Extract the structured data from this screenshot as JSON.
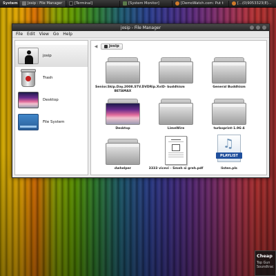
{
  "taskbar": {
    "items": [
      {
        "label": "System",
        "icon": "system-menu-icon"
      },
      {
        "label": "Josip : File Manager",
        "icon": "folder-icon"
      },
      {
        "label": "[Terminal]",
        "icon": "terminal-icon"
      },
      {
        "label": "[System Monitor]",
        "icon": "monitor-icon"
      },
      {
        "label": "[DemoWatch.com: Put t",
        "icon": "browser-icon"
      },
      {
        "label": "[...(0)9053323(E)...",
        "icon": "browser-icon"
      }
    ]
  },
  "window": {
    "title": "josip - File Manager",
    "menu": [
      "File",
      "Edit",
      "View",
      "Go",
      "Help"
    ]
  },
  "sidebar": {
    "items": [
      {
        "label": "josip",
        "icon": "home-user-icon",
        "selected": true
      },
      {
        "label": "Trash",
        "icon": "trash-icon",
        "selected": false
      },
      {
        "label": "Desktop",
        "icon": "desktop-icon",
        "selected": false
      },
      {
        "label": "File System",
        "icon": "harddisk-icon",
        "selected": false
      }
    ]
  },
  "pathbar": {
    "current": "josip"
  },
  "files": [
    {
      "name": "Senior.Skip.Day.2008.STV.DVDRip.XviD-BETAMAX",
      "type": "folder"
    },
    {
      "name": "buddhism",
      "type": "folder"
    },
    {
      "name": "General Buddhism",
      "type": "folder"
    },
    {
      "name": "Desktop",
      "type": "desktop-folder"
    },
    {
      "name": "LimeWire",
      "type": "folder"
    },
    {
      "name": "turboprint-1.96-4",
      "type": "folder"
    },
    {
      "name": "dwhelper",
      "type": "folder"
    },
    {
      "name": "3333 vicevi - Smeh si greh.pdf",
      "type": "pdf"
    },
    {
      "name": "listen.pls",
      "type": "playlist",
      "badge": "PLAYLIST"
    }
  ],
  "notification": {
    "title": "Cheap",
    "body_line1": "Top Gun",
    "body_line2": "Soundtrac"
  }
}
